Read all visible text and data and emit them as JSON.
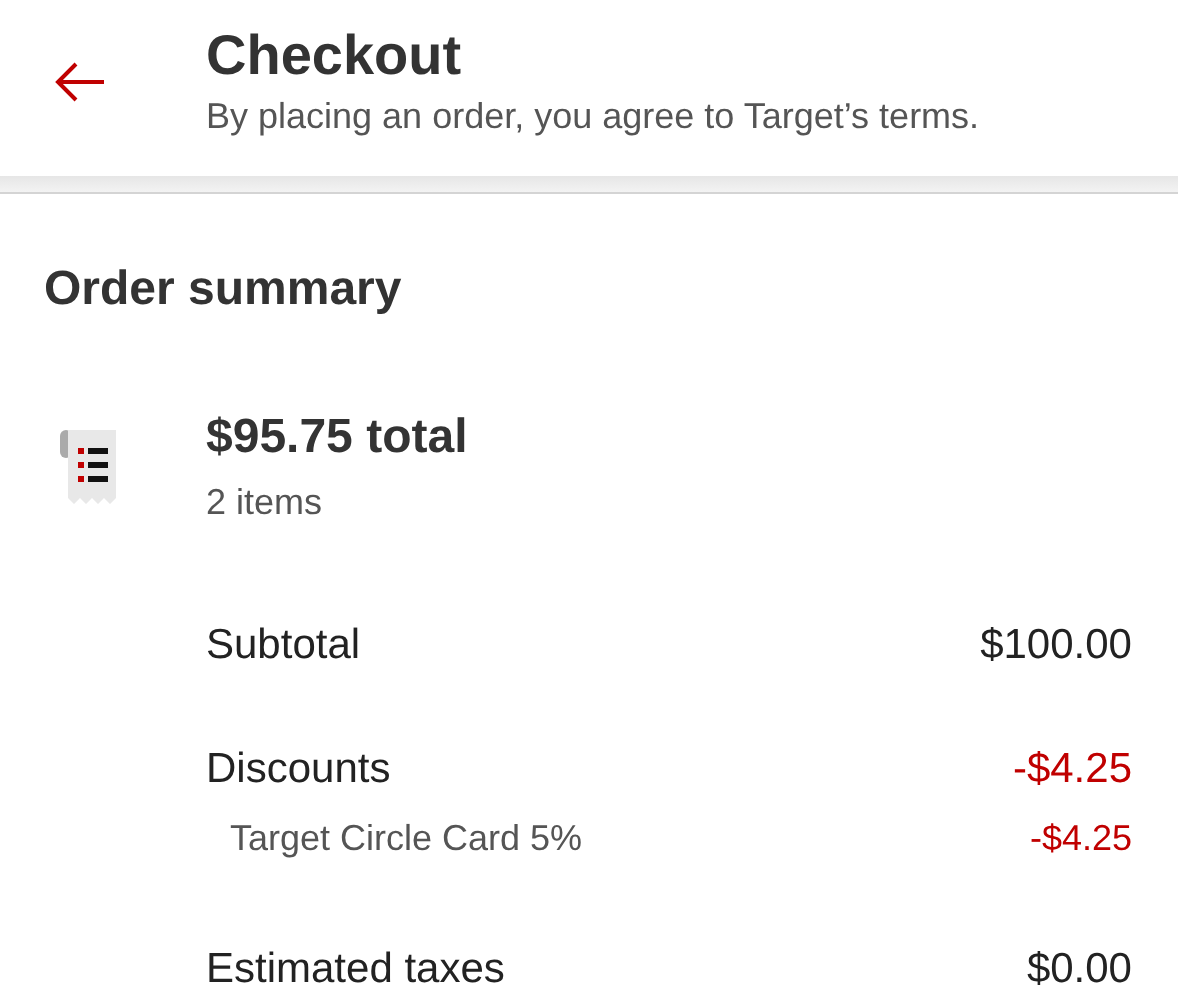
{
  "header": {
    "title": "Checkout",
    "subtitle": "By placing an order, you agree to Target’s terms."
  },
  "summary": {
    "heading": "Order summary",
    "total": "$95.75 total",
    "items": "2 items",
    "lines": [
      {
        "kind": "charge",
        "label": "Subtotal",
        "amount": "$100.00"
      },
      {
        "kind": "discount",
        "label": "Discounts",
        "amount": "-$4.25"
      },
      {
        "kind": "discount-detail",
        "label": "Target Circle Card 5%",
        "amount": "-$4.25"
      },
      {
        "kind": "charge",
        "label": "Estimated taxes",
        "amount": "$0.00"
      }
    ]
  }
}
